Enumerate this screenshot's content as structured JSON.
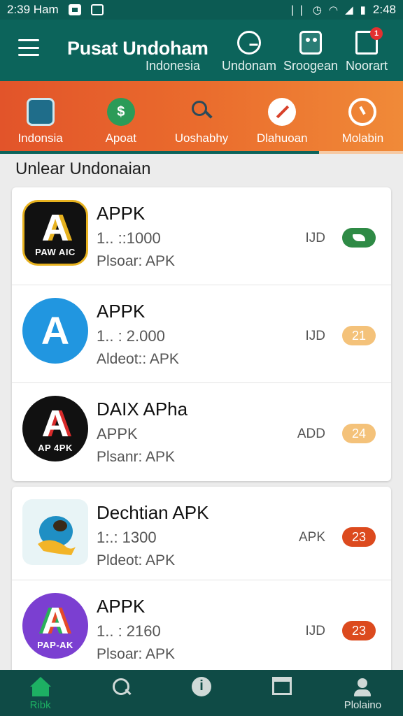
{
  "status_bar": {
    "time_left": "2:39 Ham",
    "time_right": "2:48",
    "icons": [
      "notification-icon",
      "screen-icon",
      "vibrate-icon",
      "alarm-icon",
      "wifi-icon",
      "signal-icon",
      "battery-icon"
    ]
  },
  "app_bar": {
    "title": "Pusat Undoham",
    "subtitle": "Indonesia",
    "actions": [
      {
        "label": "Undonam",
        "icon": "clock-icon"
      },
      {
        "label": "Sroogean",
        "icon": "store-icon"
      },
      {
        "label": "Noorart",
        "icon": "screen-icon",
        "badge": "1"
      }
    ]
  },
  "categories": [
    {
      "label": "Indonsia",
      "icon": "folder-icon"
    },
    {
      "label": "Apoat",
      "icon": "dollar-icon",
      "glyph": "$"
    },
    {
      "label": "Uoshabhy",
      "icon": "search-icon"
    },
    {
      "label": "Dlahuoan",
      "icon": "check-icon"
    },
    {
      "label": "Molabin",
      "icon": "timer-icon"
    }
  ],
  "section_title": "Unlear Undonaian",
  "apps": [
    {
      "name": "APPK",
      "version": "1.. ::1000",
      "meta": "Plsoar: APK",
      "label": "IJD",
      "pill": "",
      "pill_color": "#2e8a45",
      "icon_big": "A",
      "icon_small": "PAW AIC"
    },
    {
      "name": "APPK",
      "version": "1.. : 2.000",
      "meta": "Aldeot:: APK",
      "label": "IJD",
      "pill": "21",
      "pill_color": "#f4c27a",
      "icon_big": "A",
      "icon_small": ""
    },
    {
      "name": "DAIX APha",
      "version": "APPK",
      "meta": "Plsanr: APK",
      "label": "ADD",
      "pill": "24",
      "pill_color": "#f4c27a",
      "icon_big": "A",
      "icon_small": "AP 4PK"
    },
    {
      "name": "Dechtian APK",
      "version": "1:.: 1300",
      "meta": "Pldeot: APK",
      "label": "APK",
      "pill": "23",
      "pill_color": "#dc4a1e",
      "icon_big": "",
      "icon_small": ""
    },
    {
      "name": "APPK",
      "version": "1.. : 2160",
      "meta": "Plsoar: APK",
      "label": "IJD",
      "pill": "23",
      "pill_color": "#dc4a1e",
      "icon_big": "A",
      "icon_small": "PAP-AK"
    }
  ],
  "bottom_nav": [
    {
      "label": "Ribk",
      "icon": "home-icon",
      "active": true
    },
    {
      "label": "",
      "icon": "search-icon"
    },
    {
      "label": "",
      "icon": "info-icon"
    },
    {
      "label": "",
      "icon": "window-icon"
    },
    {
      "label": "Plolaino",
      "icon": "profile-icon"
    }
  ],
  "colors": {
    "primary": "#0c645b",
    "accent_orange": "#ea6c2d",
    "active_green": "#1db063"
  }
}
